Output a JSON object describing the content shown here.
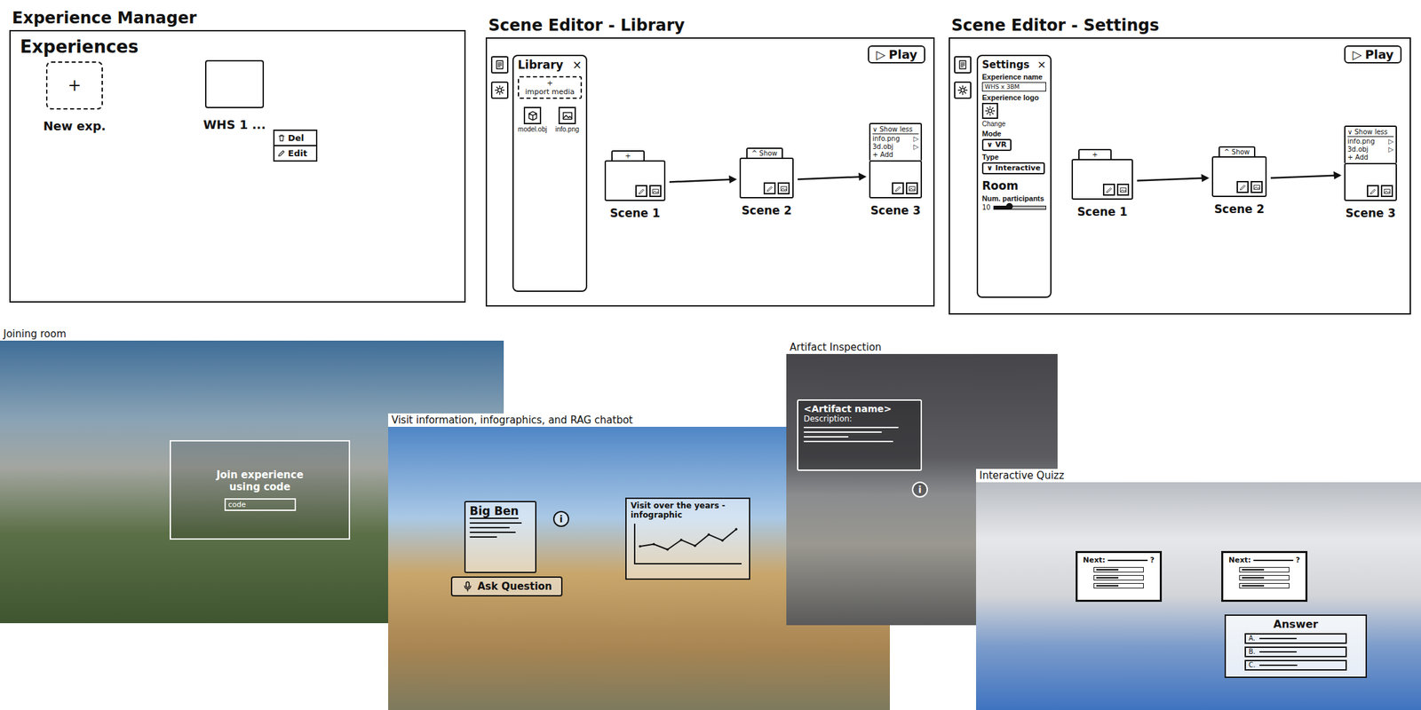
{
  "experience_manager": {
    "title": "Experience Manager",
    "heading": "Experiences",
    "cards": [
      {
        "kind": "new",
        "symbol": "+",
        "label": "New exp."
      },
      {
        "kind": "existing",
        "label": "WHS 1 ..."
      }
    ],
    "menu": [
      {
        "kind": "delete",
        "label": "Del"
      },
      {
        "kind": "edit",
        "label": "Edit"
      }
    ]
  },
  "library_editor": {
    "title": "Scene Editor - Library",
    "play": {
      "icon": "▷",
      "label": "Play"
    },
    "library": {
      "title": "Library",
      "close": "×",
      "import": {
        "icon": "+",
        "label": "import media"
      },
      "items": [
        {
          "kind": "model",
          "label": "model.obj"
        },
        {
          "kind": "image",
          "label": "info.png"
        }
      ]
    },
    "scenes": [
      {
        "label": "Scene 1",
        "toggle": "+",
        "expanded": false
      },
      {
        "label": "Scene 2",
        "toggle": "^ Show",
        "expanded": false
      },
      {
        "label": "Scene 3",
        "toggle": "∨ Show less",
        "expanded": true,
        "items": [
          {
            "label": "info.png",
            "arrow": "▷"
          },
          {
            "label": "3d.obj",
            "arrow": "▷"
          }
        ],
        "add": "+ Add"
      }
    ]
  },
  "settings_editor": {
    "title": "Scene Editor - Settings",
    "play": {
      "icon": "▷",
      "label": "Play"
    },
    "settings": {
      "title": "Settings",
      "close": "×",
      "fields": [
        {
          "kind": "text",
          "label": "Experience name",
          "value": "WHS x 3BM"
        },
        {
          "kind": "logo",
          "label": "Experience logo",
          "action": "Change"
        },
        {
          "kind": "select",
          "label": "Mode",
          "value": "∨ VR"
        },
        {
          "kind": "select",
          "label": "Type",
          "value": "∨ Interactive"
        },
        {
          "kind": "heading",
          "label": "Room"
        },
        {
          "kind": "slider",
          "label": "Num. participants",
          "reading": "10",
          "level": 0.3
        }
      ]
    },
    "scenes": [
      {
        "label": "Scene 1",
        "toggle": "+",
        "expanded": false
      },
      {
        "label": "Scene 2",
        "toggle": "^ Show",
        "expanded": false
      },
      {
        "label": "Scene 3",
        "toggle": "∨ Show less",
        "expanded": true,
        "items": [
          {
            "label": "info.png",
            "arrow": "▷"
          },
          {
            "label": "3d.obj",
            "arrow": "▷"
          }
        ],
        "add": "+ Add"
      }
    ]
  },
  "joining_room": {
    "caption": "Joining room",
    "dialog": {
      "title": "Join experience using code",
      "placeholder": "code"
    }
  },
  "visit_info": {
    "caption": "Visit information, infographics, and RAG chatbot",
    "info_card": {
      "title": "Big Ben",
      "info_icon": "i"
    },
    "ask": {
      "label": "Ask Question"
    },
    "infographic": {
      "title": "Visit over the years - infographic",
      "values": [
        3,
        3.4,
        2.4,
        4.2,
        3.1,
        5.2,
        4.1,
        6.2
      ]
    }
  },
  "artifact_inspection": {
    "caption": "Artifact Inspection",
    "card": {
      "title": "<Artifact name>",
      "description": "Description:"
    },
    "info_icon": "i"
  },
  "interactive_quiz": {
    "caption": "Interactive Quizz",
    "screens": [
      {
        "label": "Next:",
        "question": "?"
      },
      {
        "label": "Next:",
        "question": "?"
      }
    ],
    "answer": {
      "title": "Answer",
      "options": [
        "A.",
        "B.",
        "C."
      ]
    }
  }
}
